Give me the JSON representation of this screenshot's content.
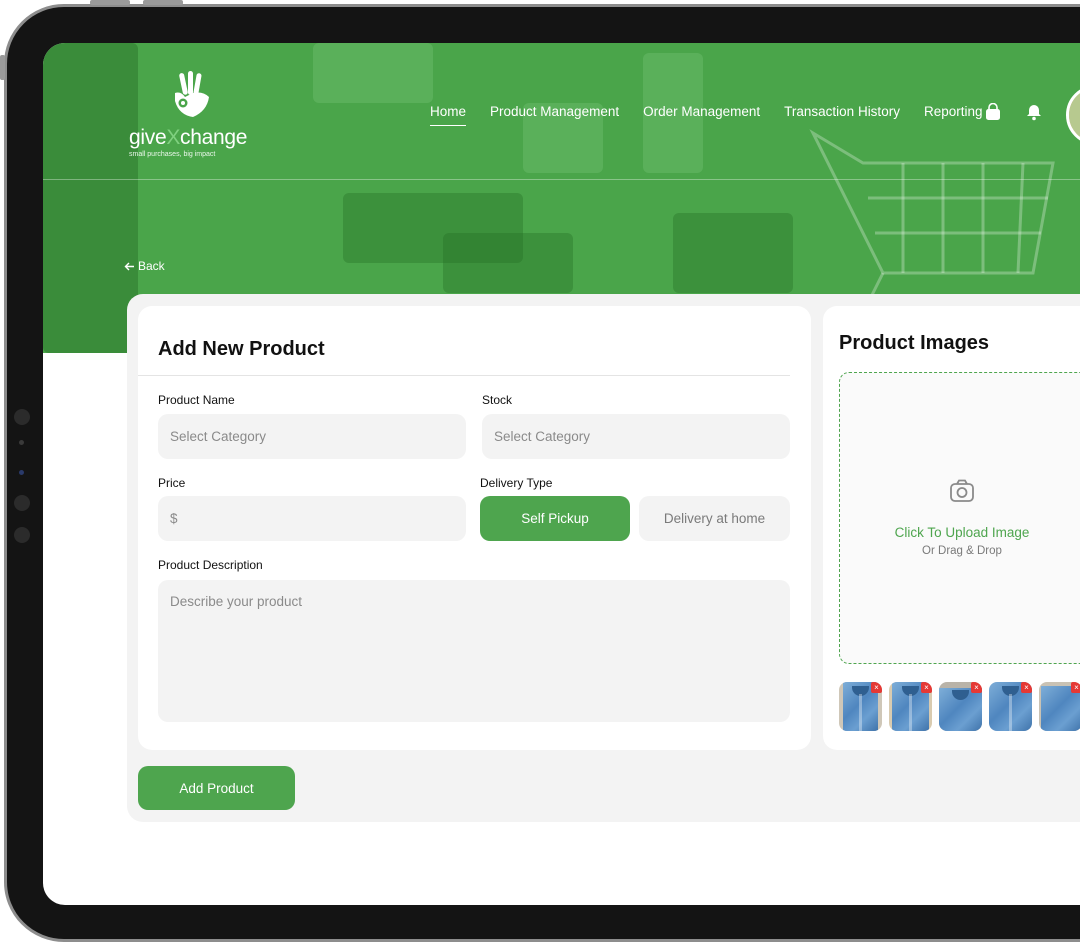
{
  "brand": {
    "name_part1": "give",
    "name_x": "X",
    "name_part2": "change",
    "tagline": "small purchases, big impact"
  },
  "nav": {
    "items": [
      {
        "label": "Home",
        "active": true
      },
      {
        "label": "Product Management",
        "active": false
      },
      {
        "label": "Order Management",
        "active": false
      },
      {
        "label": "Transaction History",
        "active": false
      },
      {
        "label": "Reporting",
        "active": false
      }
    ],
    "icons": [
      "shopping-bag-icon",
      "bell-icon"
    ]
  },
  "back_label": "Back",
  "form": {
    "title": "Add New Product",
    "product_name": {
      "label": "Product Name",
      "placeholder": "Select Category"
    },
    "stock": {
      "label": "Stock",
      "placeholder": "Select Category"
    },
    "price": {
      "label": "Price",
      "placeholder": "$"
    },
    "delivery": {
      "label": "Delivery Type",
      "options": [
        {
          "label": "Self Pickup",
          "selected": true
        },
        {
          "label": "Delivery at home",
          "selected": false
        }
      ]
    },
    "description": {
      "label": "Product Description",
      "placeholder": "Describe your product"
    },
    "submit_label": "Add Product"
  },
  "images": {
    "title": "Product Images",
    "upload_label": "Click To Upload Image",
    "upload_sub": "Or Drag & Drop",
    "thumbnails": 5,
    "remove_glyph": "×"
  },
  "colors": {
    "brand_green": "#4ea54e",
    "hero_green": "#4aa54a",
    "remove_red": "#e53935"
  }
}
